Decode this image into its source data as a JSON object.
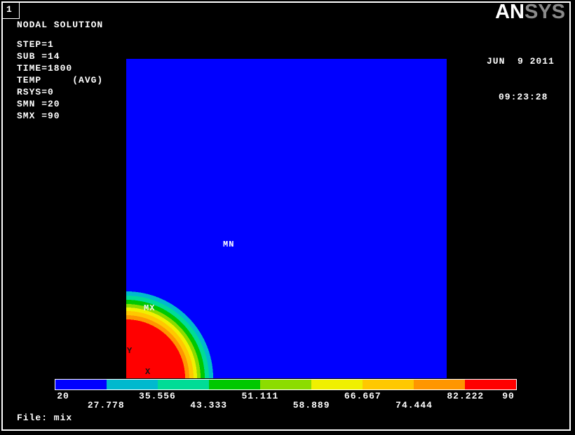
{
  "window": {
    "number": "1"
  },
  "logo": {
    "an": "AN",
    "sys": "SYS"
  },
  "header": {
    "date": "JUN  9 2011",
    "time": "09:23:28"
  },
  "annotation": {
    "title": "NODAL SOLUTION",
    "lines": [
      "STEP=1",
      "SUB =14",
      "TIME=1800",
      "TEMP     (AVG)",
      "RSYS=0",
      "SMN =20",
      "SMX =90"
    ]
  },
  "plot": {
    "min_marker": "MN",
    "max_marker": "MX",
    "axis_x": "X",
    "axis_y": "Y",
    "field_color": "#0000ff",
    "hot_color": "#ff0000"
  },
  "legend": {
    "segments": [
      "#0000ff",
      "#00b9ce",
      "#00dc96",
      "#00c800",
      "#8cdc00",
      "#f0f000",
      "#ffc800",
      "#ff9600",
      "#ff0000"
    ],
    "labels": [
      {
        "text": "20",
        "row": 1
      },
      {
        "text": "27.778",
        "row": 2
      },
      {
        "text": "35.556",
        "row": 1
      },
      {
        "text": "43.333",
        "row": 2
      },
      {
        "text": "51.111",
        "row": 1
      },
      {
        "text": "58.889",
        "row": 2
      },
      {
        "text": "66.667",
        "row": 1
      },
      {
        "text": "74.444",
        "row": 2
      },
      {
        "text": "82.222",
        "row": 1
      },
      {
        "text": "90",
        "row": 1
      }
    ]
  },
  "footer": {
    "file_label": "File: mix"
  },
  "chart_data": {
    "type": "heatmap",
    "title": "NODAL SOLUTION  TEMP (AVG)",
    "step": "STEP=1",
    "substep": "SUB =14",
    "time": "TIME=1800",
    "smn": 20,
    "smx": 90,
    "contour_levels": [
      20,
      27.778,
      35.556,
      43.333,
      51.111,
      58.889,
      66.667,
      74.444,
      82.222,
      90
    ],
    "colors_low_to_high": [
      "#0000ff",
      "#00b9ce",
      "#00dc96",
      "#00c800",
      "#8cdc00",
      "#f0f000",
      "#ffc800",
      "#ff9600",
      "#ff0000"
    ],
    "pattern": "Square domain uniformly at minimum temperature 20 (blue) with a hot quarter-circular zone near maximum 90 (red) centered on the bottom-left corner, surrounded by thin concentric rainbow contour bands; MN marker in the blue field, MX marker at the hot zone edge"
  }
}
